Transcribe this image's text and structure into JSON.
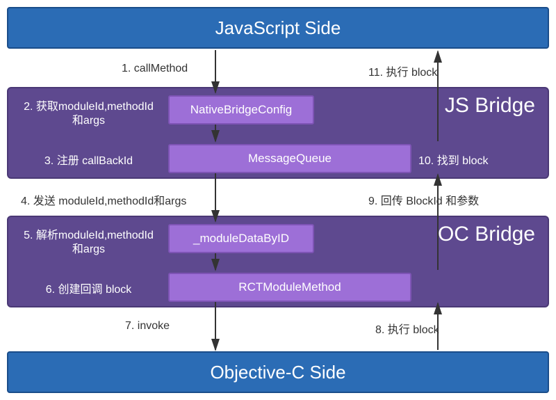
{
  "top": {
    "title": "JavaScript Side"
  },
  "bottom": {
    "title": "Objective-C Side"
  },
  "jsBridge": {
    "title": "JS Bridge",
    "box1": "NativeBridgeConfig",
    "box2": "MessageQueue"
  },
  "ocBridge": {
    "title": "OC Bridge",
    "box1": "_moduleDataByID",
    "box2": "RCTModuleMethod"
  },
  "steps": {
    "s1": "1. callMethod",
    "s2a": "2. 获取moduleId,methodId",
    "s2b": "和args",
    "s3": "3. 注册 callBackId",
    "s4": "4. 发送 moduleId,methodId和args",
    "s5a": "5. 解析moduleId,methodId",
    "s5b": "和args",
    "s6": "6. 创建回调 block",
    "s7": "7. invoke",
    "s8": "8. 执行 block",
    "s9": "9. 回传 BlockId 和参数",
    "s10": "10. 找到 block",
    "s11": "11. 执行 block"
  },
  "colors": {
    "blue": "#2b6cb5",
    "purpleDark": "#5e498f",
    "purpleLight": "#9d6fd7"
  }
}
